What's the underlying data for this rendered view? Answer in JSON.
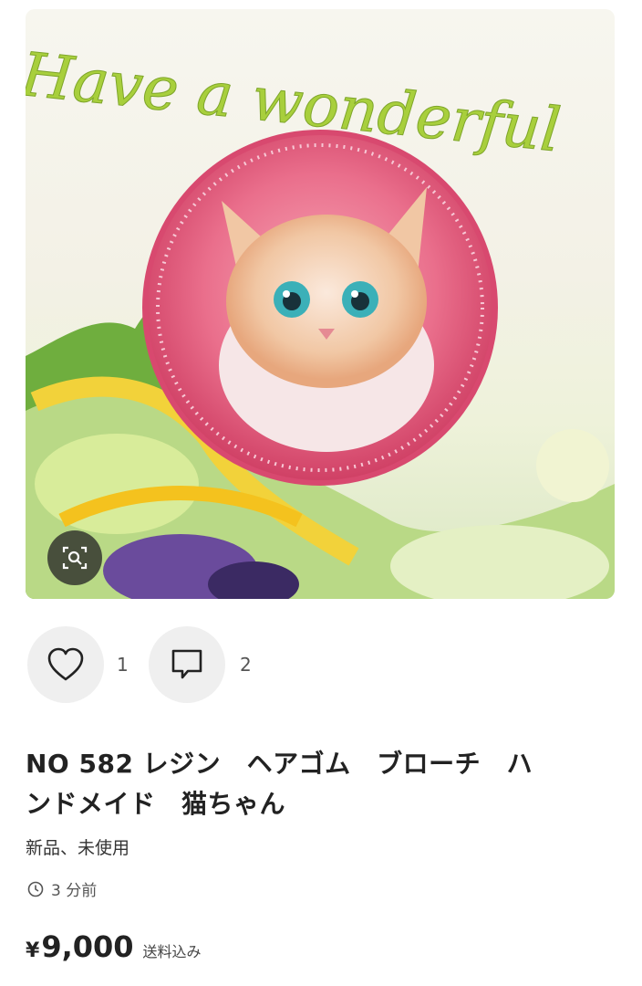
{
  "photo": {
    "overlay_text": "Have a wonderful",
    "lens_button_icon": "image-search-icon"
  },
  "actions": {
    "like": {
      "icon": "heart-icon",
      "count": "1"
    },
    "comment": {
      "icon": "comment-icon",
      "count": "2"
    }
  },
  "item": {
    "title_line1": "NO 582 レジン　ヘアゴム　ブローチ　ハ",
    "title_line2": "ンドメイド　猫ちゃん",
    "condition": "新品、未使用",
    "posted": "3 分前",
    "currency": "¥",
    "price": "9,000",
    "shipping": "送料込み"
  },
  "colors": {
    "script_text": "#a8cf3c",
    "badge_pink": "#e8456f",
    "button_bg": "#efefef"
  }
}
